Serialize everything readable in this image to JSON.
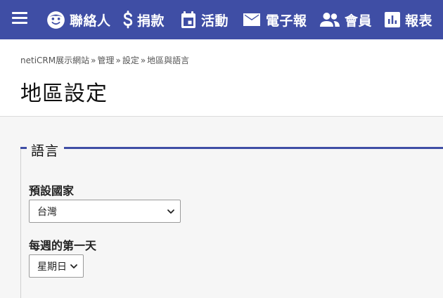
{
  "nav": {
    "items": [
      {
        "label": "聯絡人",
        "icon": "contacts-face-icon"
      },
      {
        "label": "捐款",
        "icon": "dollar-sign-icon"
      },
      {
        "label": "活動",
        "icon": "calendar-event-icon"
      },
      {
        "label": "電子報",
        "icon": "mail-envelope-icon"
      },
      {
        "label": "會員",
        "icon": "people-group-icon"
      },
      {
        "label": "報表",
        "icon": "bar-chart-icon"
      }
    ]
  },
  "breadcrumb": {
    "items": [
      "netiCRM展示網站",
      "管理",
      "設定",
      "地區與語言"
    ],
    "separator": "»"
  },
  "page": {
    "title": "地區設定"
  },
  "fieldset": {
    "legend": "語言",
    "fields": [
      {
        "label": "預設國家",
        "value": "台灣"
      },
      {
        "label": "每週的第一天",
        "value": "星期日"
      }
    ]
  },
  "colors": {
    "brand": "#3f4ea5",
    "background": "#f6f6f6"
  }
}
